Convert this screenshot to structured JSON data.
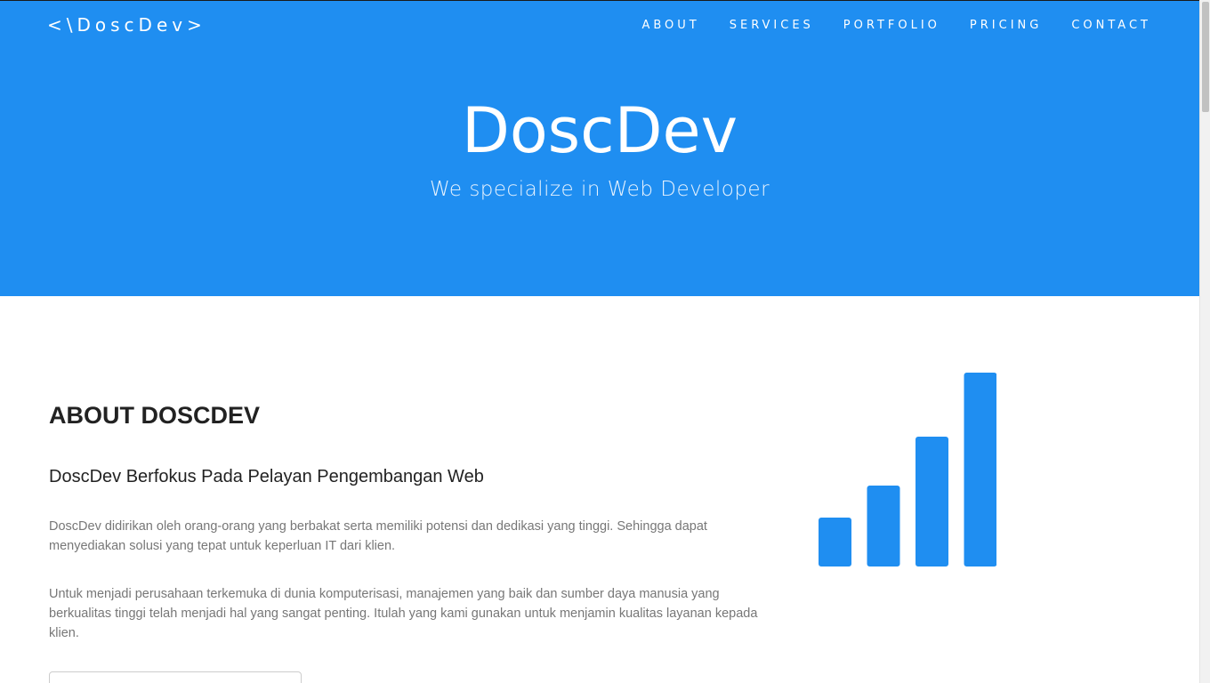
{
  "header": {
    "brand": "<\\DoscDev>",
    "nav": [
      "ABOUT",
      "SERVICES",
      "PORTFOLIO",
      "PRICING",
      "CONTACT"
    ]
  },
  "hero": {
    "title": "DoscDev",
    "subtitle": "We specialize in Web Developer"
  },
  "about": {
    "heading": "ABOUT DOSCDEV",
    "subheading": "DoscDev Berfokus Pada Pelayan Pengembangan Web",
    "paragraphs": [
      "DoscDev didirikan oleh orang-orang yang berbakat serta memiliki potensi dan dedikasi yang tinggi. Sehingga dapat menyediakan solusi yang tepat untuk keperluan IT dari klien.",
      "Untuk menjadi perusahaan terkemuka di dunia komputerisasi, manajemen yang baik dan sumber daya manusia yang berkualitas tinggi telah menjadi hal yang sangat penting. Itulah yang kami gunakan untuk menjamin kualitas layanan kepada klien."
    ],
    "illustration_icon": "signal-bars-icon"
  },
  "colors": {
    "primary": "#1f8ef1",
    "heading_text": "#222222",
    "body_text": "#777777"
  }
}
